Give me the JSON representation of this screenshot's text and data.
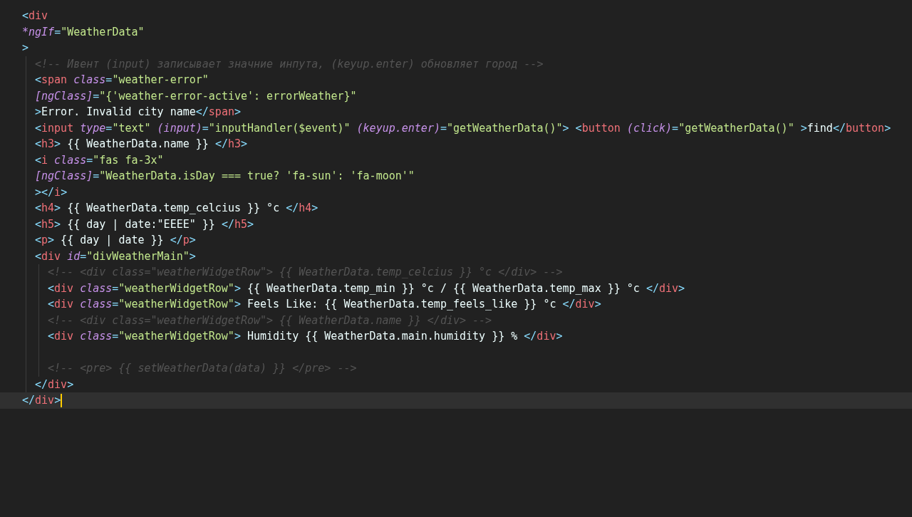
{
  "editor": {
    "lines": [
      {
        "current": false,
        "tokens": [
          {
            "kind": "punct",
            "text": "<"
          },
          {
            "kind": "tag",
            "text": "div"
          }
        ]
      },
      {
        "current": false,
        "tokens": [
          {
            "kind": "attr",
            "text": "*ngIf"
          },
          {
            "kind": "punct",
            "text": "="
          },
          {
            "kind": "string",
            "text": "\"WeatherData\""
          }
        ]
      },
      {
        "current": false,
        "tokens": [
          {
            "kind": "punct",
            "text": ">"
          }
        ],
        "children": [
          {
            "current": false,
            "tokens": [
              {
                "kind": "comment",
                "text": "<!-- Ивент (input) записывает значние инпута, (keyup.enter) обновляет город -->"
              }
            ]
          },
          {
            "current": false,
            "tokens": [
              {
                "kind": "punct",
                "text": "<"
              },
              {
                "kind": "tag",
                "text": "span"
              },
              {
                "kind": "attr",
                "text": " class"
              },
              {
                "kind": "punct",
                "text": "="
              },
              {
                "kind": "string",
                "text": "\"weather-error\""
              }
            ]
          },
          {
            "current": false,
            "tokens": [
              {
                "kind": "attr",
                "text": "[ngClass]"
              },
              {
                "kind": "punct",
                "text": "="
              },
              {
                "kind": "string",
                "text": "\"{'weather-error-active': errorWeather}\""
              }
            ]
          },
          {
            "current": false,
            "tokens": [
              {
                "kind": "punct",
                "text": ">"
              },
              {
                "kind": "text",
                "text": "Error. Invalid city name"
              },
              {
                "kind": "punct",
                "text": "</"
              },
              {
                "kind": "tag",
                "text": "span"
              },
              {
                "kind": "punct",
                "text": ">"
              }
            ]
          },
          {
            "current": false,
            "tokens": [
              {
                "kind": "punct",
                "text": "<"
              },
              {
                "kind": "tag",
                "text": "input"
              },
              {
                "kind": "attr",
                "text": " type"
              },
              {
                "kind": "punct",
                "text": "="
              },
              {
                "kind": "string",
                "text": "\"text\""
              },
              {
                "kind": "attr",
                "text": " (input)"
              },
              {
                "kind": "punct",
                "text": "="
              },
              {
                "kind": "string",
                "text": "\"inputHandler($event)\""
              },
              {
                "kind": "attr",
                "text": " (keyup.enter)"
              },
              {
                "kind": "punct",
                "text": "="
              },
              {
                "kind": "string",
                "text": "\"getWeatherData()\""
              },
              {
                "kind": "punct",
                "text": "> <"
              },
              {
                "kind": "tag",
                "text": "button"
              },
              {
                "kind": "attr",
                "text": " (click)"
              },
              {
                "kind": "punct",
                "text": "="
              },
              {
                "kind": "string",
                "text": "\"getWeatherData()\""
              },
              {
                "kind": "punct",
                "text": " >"
              },
              {
                "kind": "text",
                "text": "find"
              },
              {
                "kind": "punct",
                "text": "</"
              },
              {
                "kind": "tag",
                "text": "button"
              },
              {
                "kind": "punct",
                "text": ">"
              }
            ]
          },
          {
            "current": false,
            "tokens": [
              {
                "kind": "punct",
                "text": "<"
              },
              {
                "kind": "tag",
                "text": "h3"
              },
              {
                "kind": "punct",
                "text": ">"
              },
              {
                "kind": "text",
                "text": " {{ WeatherData.name }} "
              },
              {
                "kind": "punct",
                "text": "</"
              },
              {
                "kind": "tag",
                "text": "h3"
              },
              {
                "kind": "punct",
                "text": ">"
              }
            ]
          },
          {
            "current": false,
            "tokens": [
              {
                "kind": "punct",
                "text": "<"
              },
              {
                "kind": "tag",
                "text": "i"
              },
              {
                "kind": "attr",
                "text": " class"
              },
              {
                "kind": "punct",
                "text": "="
              },
              {
                "kind": "string",
                "text": "\"fas fa-3x\""
              }
            ]
          },
          {
            "current": false,
            "tokens": [
              {
                "kind": "attr",
                "text": "[ngClass]"
              },
              {
                "kind": "punct",
                "text": "="
              },
              {
                "kind": "string",
                "text": "\"WeatherData.isDay === true? 'fa-sun': 'fa-moon'\""
              }
            ]
          },
          {
            "current": false,
            "tokens": [
              {
                "kind": "punct",
                "text": "></"
              },
              {
                "kind": "tag",
                "text": "i"
              },
              {
                "kind": "punct",
                "text": ">"
              }
            ]
          },
          {
            "current": false,
            "tokens": [
              {
                "kind": "punct",
                "text": "<"
              },
              {
                "kind": "tag",
                "text": "h4"
              },
              {
                "kind": "punct",
                "text": ">"
              },
              {
                "kind": "text",
                "text": " {{ WeatherData.temp_celcius }} °c "
              },
              {
                "kind": "punct",
                "text": "</"
              },
              {
                "kind": "tag",
                "text": "h4"
              },
              {
                "kind": "punct",
                "text": ">"
              }
            ]
          },
          {
            "current": false,
            "tokens": [
              {
                "kind": "punct",
                "text": "<"
              },
              {
                "kind": "tag",
                "text": "h5"
              },
              {
                "kind": "punct",
                "text": ">"
              },
              {
                "kind": "text",
                "text": " {{ day | date:\"EEEE\" }} "
              },
              {
                "kind": "punct",
                "text": "</"
              },
              {
                "kind": "tag",
                "text": "h5"
              },
              {
                "kind": "punct",
                "text": ">"
              }
            ]
          },
          {
            "current": false,
            "tokens": [
              {
                "kind": "punct",
                "text": "<"
              },
              {
                "kind": "tag",
                "text": "p"
              },
              {
                "kind": "punct",
                "text": ">"
              },
              {
                "kind": "text",
                "text": " {{ day | date }} "
              },
              {
                "kind": "punct",
                "text": "</"
              },
              {
                "kind": "tag",
                "text": "p"
              },
              {
                "kind": "punct",
                "text": ">"
              }
            ]
          },
          {
            "current": false,
            "tokens": [
              {
                "kind": "punct",
                "text": "<"
              },
              {
                "kind": "tag",
                "text": "div"
              },
              {
                "kind": "attr",
                "text": " id"
              },
              {
                "kind": "punct",
                "text": "="
              },
              {
                "kind": "string",
                "text": "\"divWeatherMain\""
              },
              {
                "kind": "punct",
                "text": ">"
              }
            ],
            "children": [
              {
                "current": false,
                "tokens": [
                  {
                    "kind": "comment",
                    "text": "<!-- <div class=\"weatherWidgetRow\"> {{ WeatherData.temp_celcius }} °c </div> -->"
                  }
                ]
              },
              {
                "current": false,
                "tokens": [
                  {
                    "kind": "punct",
                    "text": "<"
                  },
                  {
                    "kind": "tag",
                    "text": "div"
                  },
                  {
                    "kind": "attr",
                    "text": " class"
                  },
                  {
                    "kind": "punct",
                    "text": "="
                  },
                  {
                    "kind": "string",
                    "text": "\"weatherWidgetRow\""
                  },
                  {
                    "kind": "punct",
                    "text": ">"
                  },
                  {
                    "kind": "text",
                    "text": " {{ WeatherData.temp_min }} °c / {{ WeatherData.temp_max }} °c "
                  },
                  {
                    "kind": "punct",
                    "text": "</"
                  },
                  {
                    "kind": "tag",
                    "text": "div"
                  },
                  {
                    "kind": "punct",
                    "text": ">"
                  }
                ]
              },
              {
                "current": false,
                "tokens": [
                  {
                    "kind": "punct",
                    "text": "<"
                  },
                  {
                    "kind": "tag",
                    "text": "div"
                  },
                  {
                    "kind": "attr",
                    "text": " class"
                  },
                  {
                    "kind": "punct",
                    "text": "="
                  },
                  {
                    "kind": "string",
                    "text": "\"weatherWidgetRow\""
                  },
                  {
                    "kind": "punct",
                    "text": ">"
                  },
                  {
                    "kind": "text",
                    "text": " Feels Like: {{ WeatherData.temp_feels_like }} °c "
                  },
                  {
                    "kind": "punct",
                    "text": "</"
                  },
                  {
                    "kind": "tag",
                    "text": "div"
                  },
                  {
                    "kind": "punct",
                    "text": ">"
                  }
                ]
              },
              {
                "current": false,
                "tokens": [
                  {
                    "kind": "comment",
                    "text": "<!-- <div class=\"weatherWidgetRow\"> {{ WeatherData.name }} </div> -->"
                  }
                ]
              },
              {
                "current": false,
                "tokens": [
                  {
                    "kind": "punct",
                    "text": "<"
                  },
                  {
                    "kind": "tag",
                    "text": "div"
                  },
                  {
                    "kind": "attr",
                    "text": " class"
                  },
                  {
                    "kind": "punct",
                    "text": "="
                  },
                  {
                    "kind": "string",
                    "text": "\"weatherWidgetRow\""
                  },
                  {
                    "kind": "punct",
                    "text": ">"
                  },
                  {
                    "kind": "text",
                    "text": " Humidity {{ WeatherData.main.humidity }} % "
                  },
                  {
                    "kind": "punct",
                    "text": "</"
                  },
                  {
                    "kind": "tag",
                    "text": "div"
                  },
                  {
                    "kind": "punct",
                    "text": ">"
                  }
                ]
              },
              {
                "current": false
              },
              {
                "current": false,
                "tokens": [
                  {
                    "kind": "comment",
                    "text": "<!-- <pre> {{ setWeatherData(data) }} </pre> -->"
                  }
                ]
              }
            ]
          },
          {
            "current": false,
            "tokens": [
              {
                "kind": "punct",
                "text": "</"
              },
              {
                "kind": "tag",
                "text": "div"
              },
              {
                "kind": "punct",
                "text": ">"
              }
            ]
          }
        ]
      },
      {
        "current": true,
        "tokens": [
          {
            "kind": "punct",
            "text": "</"
          },
          {
            "kind": "tag",
            "text": "div"
          },
          {
            "kind": "punct",
            "text": ">"
          }
        ]
      }
    ]
  }
}
